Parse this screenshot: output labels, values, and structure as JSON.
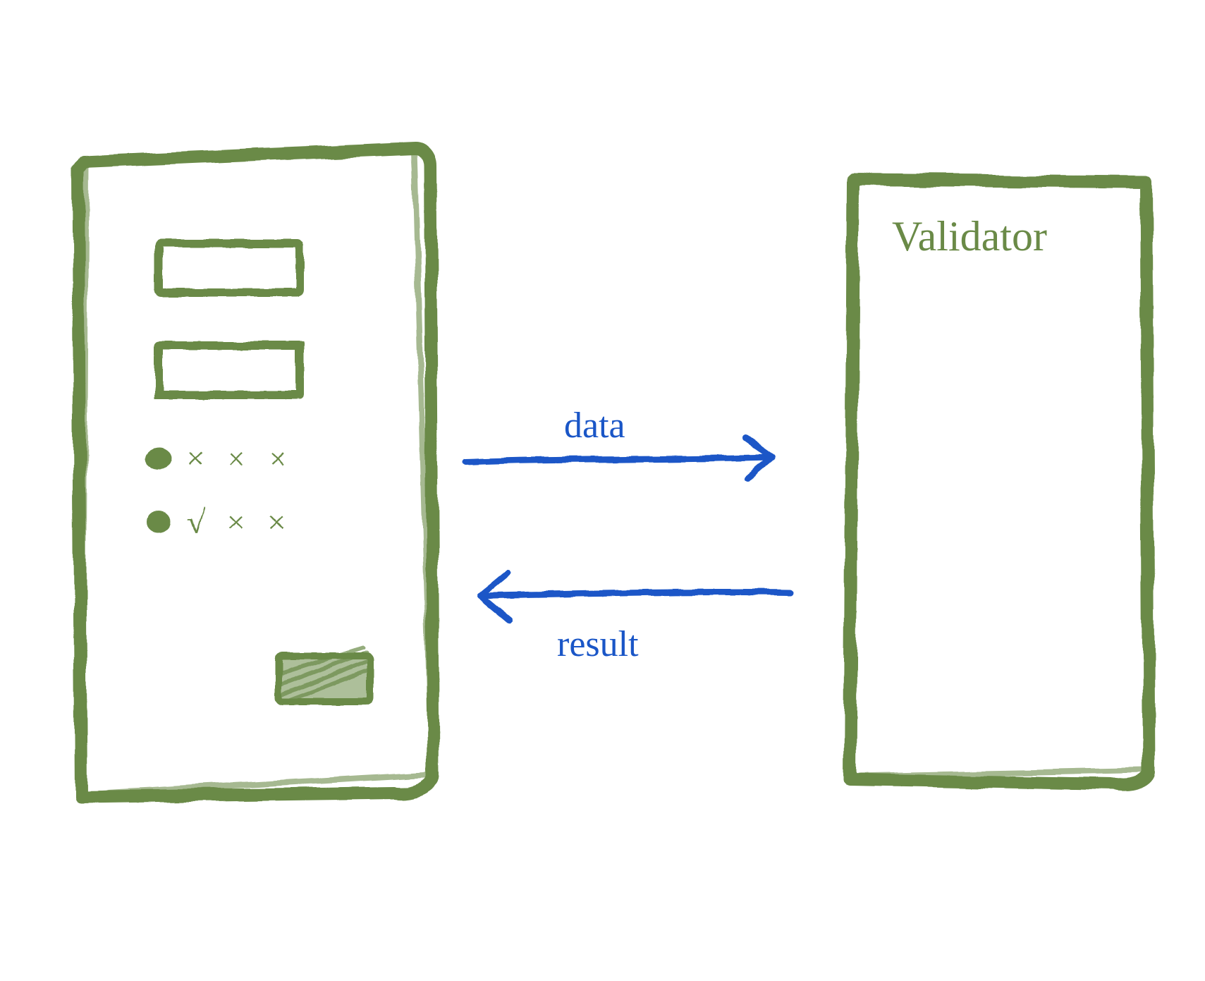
{
  "diagram": {
    "left_box": {
      "role": "form",
      "fields": [
        {
          "type": "text-input"
        },
        {
          "type": "text-input"
        }
      ],
      "radio_rows": [
        {
          "selected": true,
          "marks": "× × ×"
        },
        {
          "selected": false,
          "marks": "√ × ×"
        }
      ],
      "button": {
        "style": "filled"
      }
    },
    "right_box": {
      "title": "Validator"
    },
    "arrows": {
      "to_right": {
        "label": "data"
      },
      "to_left": {
        "label": "result"
      }
    },
    "colors": {
      "sketch_green": "#6a8a47",
      "arrow_blue": "#1a56c7"
    }
  }
}
